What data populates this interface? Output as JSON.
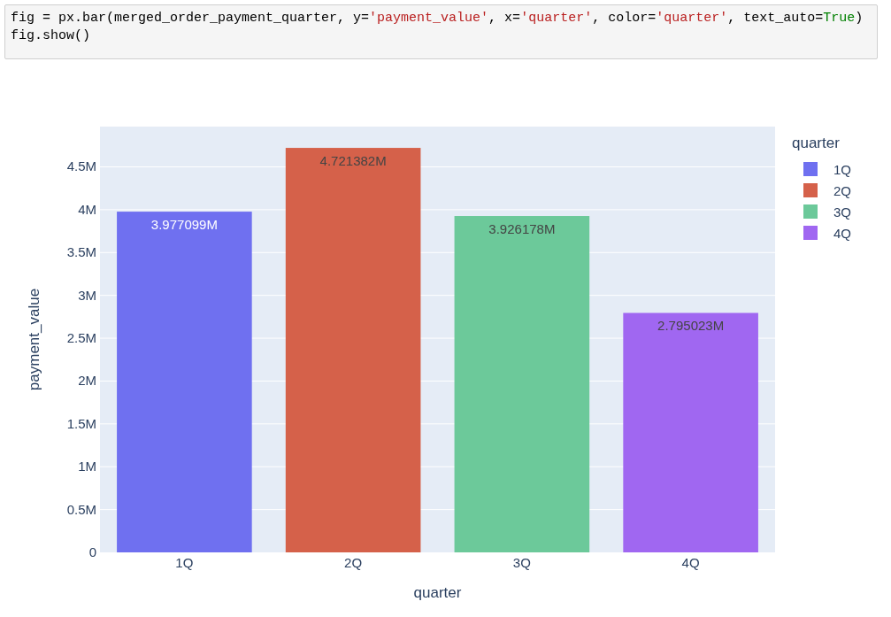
{
  "code_cell": {
    "lines": [
      [
        {
          "kind": "plain",
          "text": "fig = px.bar(merged_order_payment_quarter, y="
        },
        {
          "kind": "string",
          "text": "'payment_value'"
        },
        {
          "kind": "plain",
          "text": ", x="
        },
        {
          "kind": "string",
          "text": "'quarter'"
        },
        {
          "kind": "plain",
          "text": ", color="
        },
        {
          "kind": "string",
          "text": "'quarter'"
        },
        {
          "kind": "plain",
          "text": ", text_auto="
        },
        {
          "kind": "keyword",
          "text": "True"
        },
        {
          "kind": "plain",
          "text": ")"
        }
      ],
      [
        {
          "kind": "plain",
          "text": "fig.show()"
        }
      ]
    ]
  },
  "figure": {
    "chart_data": {
      "type": "bar",
      "grid": true,
      "legend": {
        "title": "quarter"
      },
      "xlabel": "quarter",
      "ylabel": "payment_value",
      "categories": [
        "1Q",
        "2Q",
        "3Q",
        "4Q"
      ],
      "series": [
        {
          "name": "1Q",
          "color": "#6f70f0",
          "values": [
            3977099,
            null,
            null,
            null
          ]
        },
        {
          "name": "2Q",
          "color": "#d5614a",
          "values": [
            null,
            4721382,
            null,
            null
          ]
        },
        {
          "name": "3Q",
          "color": "#6cc99a",
          "values": [
            null,
            null,
            3926178,
            null
          ]
        },
        {
          "name": "4Q",
          "color": "#a067f1",
          "values": [
            null,
            null,
            null,
            2795023
          ]
        }
      ],
      "value_labels": [
        "3.977099M",
        "4.721382M",
        "3.926178M",
        "2.795023M"
      ],
      "ylim": [
        0,
        4970000
      ],
      "yticks": [
        {
          "value": 0,
          "label": "0"
        },
        {
          "value": 500000,
          "label": "0.5M"
        },
        {
          "value": 1000000,
          "label": "1M"
        },
        {
          "value": 1500000,
          "label": "1.5M"
        },
        {
          "value": 2000000,
          "label": "2M"
        },
        {
          "value": 2500000,
          "label": "2.5M"
        },
        {
          "value": 3000000,
          "label": "3M"
        },
        {
          "value": 3500000,
          "label": "3.5M"
        },
        {
          "value": 4000000,
          "label": "4M"
        },
        {
          "value": 4500000,
          "label": "4.5M"
        }
      ],
      "orientation": "vertical"
    }
  }
}
